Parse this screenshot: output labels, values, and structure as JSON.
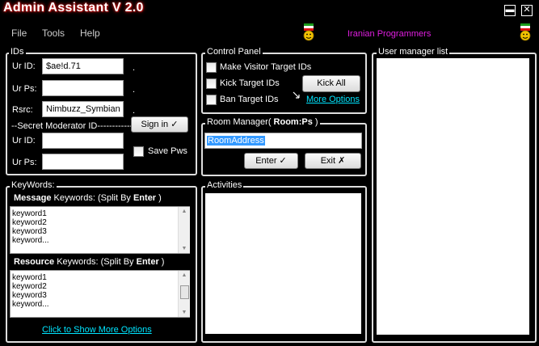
{
  "window": {
    "title": "Admin Assistant V 2.0",
    "minimize_glyph": "▬",
    "close_glyph": "✕"
  },
  "menu": {
    "file": "File",
    "tools": "Tools",
    "help": "Help"
  },
  "credit": "Iranian Programmers",
  "ids_group": {
    "legend": "IDs",
    "ur_id_label": "Ur ID:",
    "ur_id_value": "$ae!d.71",
    "ur_ps_label": "Ur Ps:",
    "ur_ps_value": "",
    "rsrc_label": "Rsrc:",
    "rsrc_value": "Nimbuzz_Symbian",
    "dot": ".",
    "secret_label": "--Secret Moderator ID------------",
    "sign_in": "Sign in ✓",
    "mod_id_label": "Ur ID:",
    "mod_id_value": "",
    "mod_ps_label": "Ur Ps:",
    "mod_ps_value": "",
    "save_pws": "Save Pws"
  },
  "control_panel": {
    "legend": "Control Panel",
    "make_visitor": "Make Visitor Target IDs",
    "kick_target": "Kick Target IDs",
    "ban_target": "Ban Target IDs",
    "kick_all": "Kick All",
    "more_options": "More Options"
  },
  "room_manager": {
    "legend_prefix": "Room Manager( ",
    "legend_bold": "Room:Ps",
    "legend_suffix": " )",
    "room_address": "RoomAddress",
    "enter": "Enter ✓",
    "exit": "Exit   ✗"
  },
  "activities": {
    "legend": "Activities"
  },
  "user_manager": {
    "legend": "User manager list"
  },
  "keywords": {
    "legend": "KeyWords:",
    "message_bold": "Message",
    "message_rest": " Keywords: (Split By ",
    "enter_bold": "Enter",
    "close_paren": " )",
    "message_lines": [
      "keyword1",
      "keyword2",
      "keyword3",
      "keyword..."
    ],
    "resource_bold": "Resource",
    "resource_rest": " Keywords: (Split By ",
    "resource_enter_bold": "Enter",
    "resource_close_paren": " )",
    "resource_lines": [
      "keyword1",
      "keyword2",
      "keyword3",
      "keyword..."
    ],
    "show_more": "Click to Show More Options"
  },
  "colors": {
    "credit": "#e01ee0",
    "link": "#00e5ff",
    "selection": "#3399ff"
  },
  "icons": {
    "face": "persian-flag-face-icon"
  }
}
